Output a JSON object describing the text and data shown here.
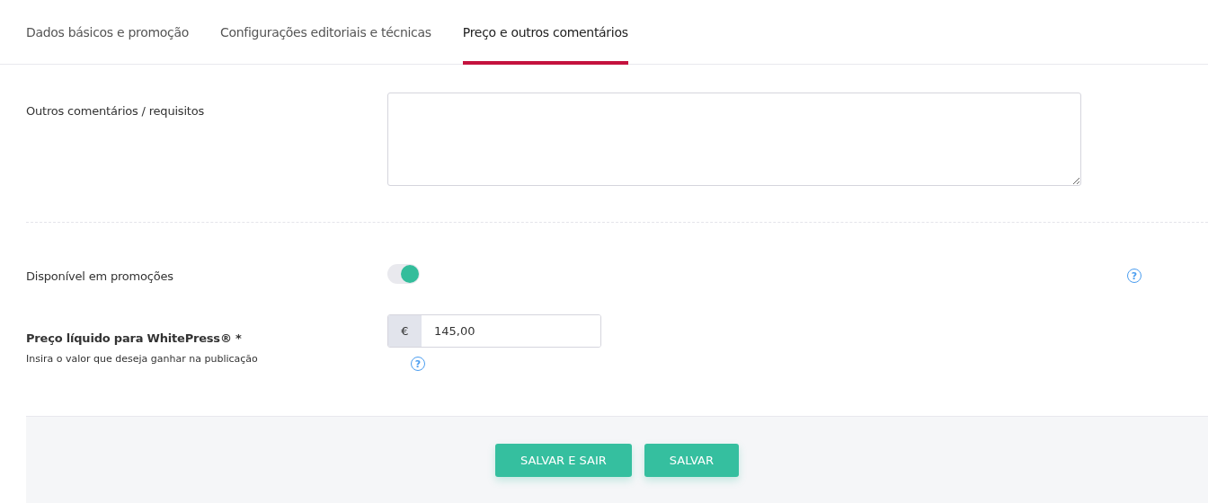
{
  "tabs": [
    {
      "label": "Dados básicos e promoção",
      "selected": false
    },
    {
      "label": "Configurações editoriais e técnicas",
      "selected": false
    },
    {
      "label": "Preço e outros comentários",
      "selected": true
    }
  ],
  "comments": {
    "label": "Outros comentários / requisitos"
  },
  "promotions": {
    "label": "Disponível em promoções",
    "on": true,
    "help": "?"
  },
  "price": {
    "label": "Preço líquido para WhitePress® *",
    "hint": "Insira o valor que deseja ganhar na publicação",
    "currency": "€",
    "value": "145,00",
    "help": "?"
  },
  "buttons": [
    "SALVAR E SAIR",
    "SALVAR"
  ]
}
